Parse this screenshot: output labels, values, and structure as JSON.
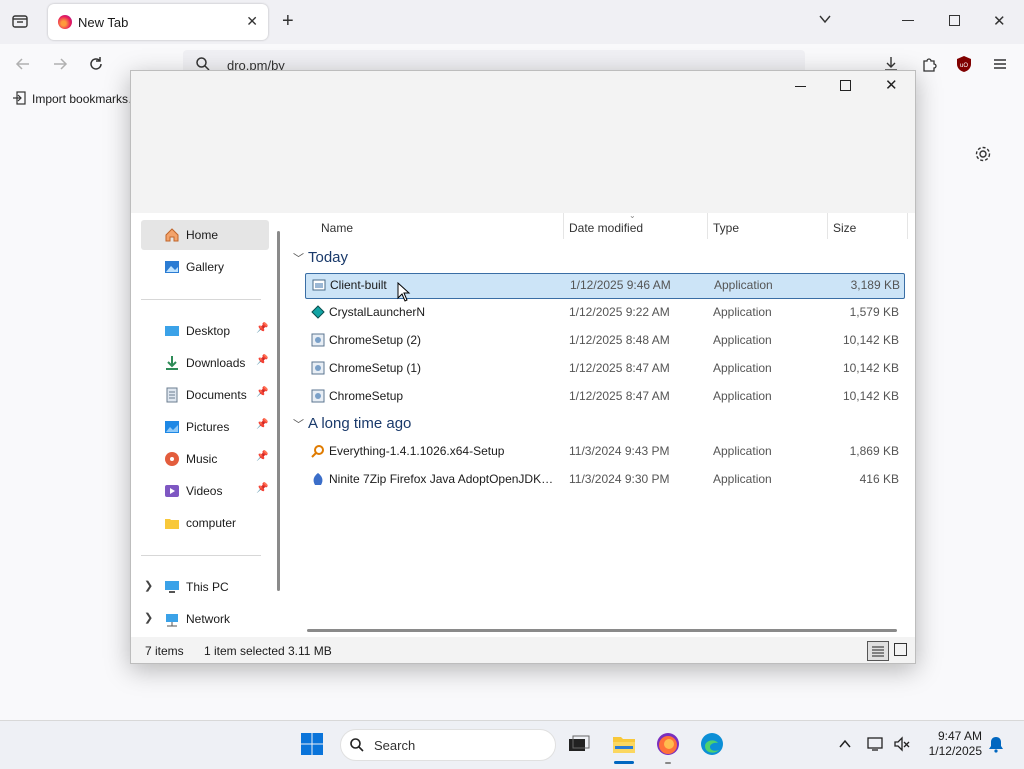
{
  "browser": {
    "tab_title": "New Tab",
    "url_text": "dro.pm/by",
    "bookmarks_label": "Import bookmarks…"
  },
  "explorer": {
    "nav": {
      "home": "Home",
      "gallery": "Gallery",
      "desktop": "Desktop",
      "downloads": "Downloads",
      "documents": "Documents",
      "pictures": "Pictures",
      "music": "Music",
      "videos": "Videos",
      "computer": "computer",
      "this_pc": "This PC",
      "network": "Network"
    },
    "columns": {
      "name": "Name",
      "date": "Date modified",
      "type": "Type",
      "size": "Size"
    },
    "groups": {
      "today": "Today",
      "long_ago": "A long time ago"
    },
    "files": [
      {
        "name": "Client-built",
        "date": "1/12/2025 9:46 AM",
        "type": "Application",
        "size": "3,189 KB"
      },
      {
        "name": "CrystalLauncherN",
        "date": "1/12/2025 9:22 AM",
        "type": "Application",
        "size": "1,579 KB"
      },
      {
        "name": "ChromeSetup (2)",
        "date": "1/12/2025 8:48 AM",
        "type": "Application",
        "size": "10,142 KB"
      },
      {
        "name": "ChromeSetup (1)",
        "date": "1/12/2025 8:47 AM",
        "type": "Application",
        "size": "10,142 KB"
      },
      {
        "name": "ChromeSetup",
        "date": "1/12/2025 8:47 AM",
        "type": "Application",
        "size": "10,142 KB"
      },
      {
        "name": "Everything-1.4.1.1026.x64-Setup",
        "date": "11/3/2024 9:43 PM",
        "type": "Application",
        "size": "1,869 KB"
      },
      {
        "name": "Ninite 7Zip Firefox Java AdoptOpenJDK x...",
        "date": "11/3/2024 9:30 PM",
        "type": "Application",
        "size": "416 KB"
      }
    ],
    "status": {
      "items": "7 items",
      "selected": "1 item selected",
      "size": "3.11 MB"
    }
  },
  "taskbar": {
    "search_label": "Search",
    "time": "9:47 AM",
    "date": "1/12/2025"
  },
  "colors": {
    "accent": "#0067c0",
    "selection": "#cce4f7",
    "firefox_orange": "#ff9a3c"
  }
}
